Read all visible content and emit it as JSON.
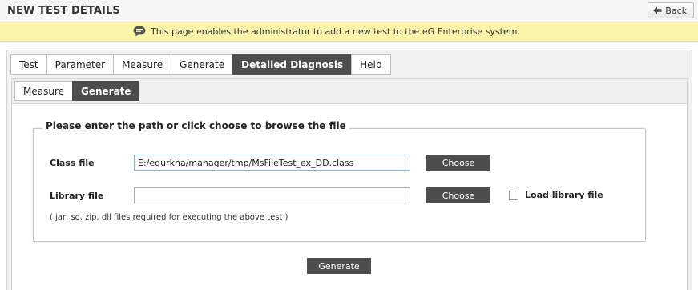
{
  "header": {
    "title": "NEW TEST DETAILS",
    "back_label": "Back"
  },
  "info": {
    "text": "This page enables the administrator to add a new test to the eG Enterprise system."
  },
  "main_tabs": [
    {
      "label": "Test",
      "active": false
    },
    {
      "label": "Parameter",
      "active": false
    },
    {
      "label": "Measure",
      "active": false
    },
    {
      "label": "Generate",
      "active": false
    },
    {
      "label": "Detailed Diagnosis",
      "active": true
    },
    {
      "label": "Help",
      "active": false
    }
  ],
  "sub_tabs": [
    {
      "label": "Measure",
      "active": false
    },
    {
      "label": "Generate",
      "active": true
    }
  ],
  "form": {
    "legend": "Please enter the path or click choose to browse the file",
    "class_file": {
      "label": "Class file",
      "value": "E:/egurkha/manager/tmp/MsFileTest_ex_DD.class",
      "choose_label": "Choose"
    },
    "library_file": {
      "label": "Library file",
      "value": "",
      "choose_label": "Choose"
    },
    "load_library": {
      "label": "Load library file",
      "checked": false
    },
    "note": "( jar, so, zip, dll files required for executing the above test )"
  },
  "generate_label": "Generate",
  "colors": {
    "info_bar": "#fbf5a9",
    "active_tab": "#4d4d4d",
    "button": "#4d4d4d"
  }
}
